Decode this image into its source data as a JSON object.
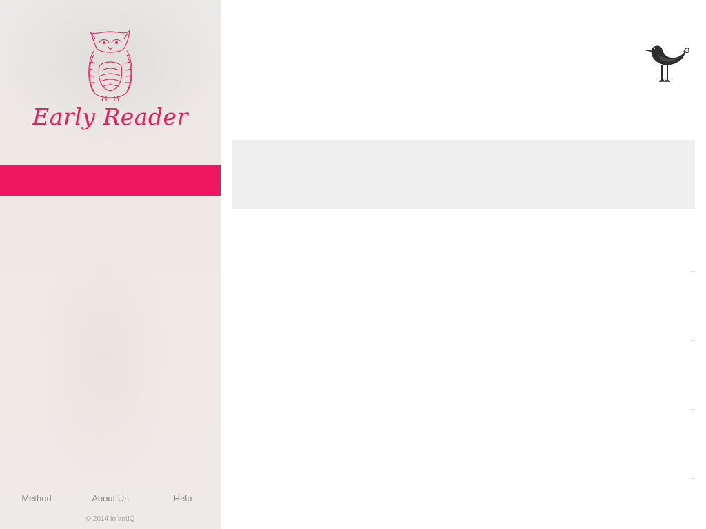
{
  "sidebar": {
    "brand_title": "Early Reader",
    "footer_links": [
      "Method",
      "About Us",
      "Help"
    ],
    "copyright": "© 2014 InfantIQ"
  },
  "icons": {
    "logo": "owl-icon",
    "header": "bird-icon"
  },
  "colors": {
    "accent": "#ef1660",
    "brand_text": "#ea1d63",
    "panel": "#efefef"
  }
}
